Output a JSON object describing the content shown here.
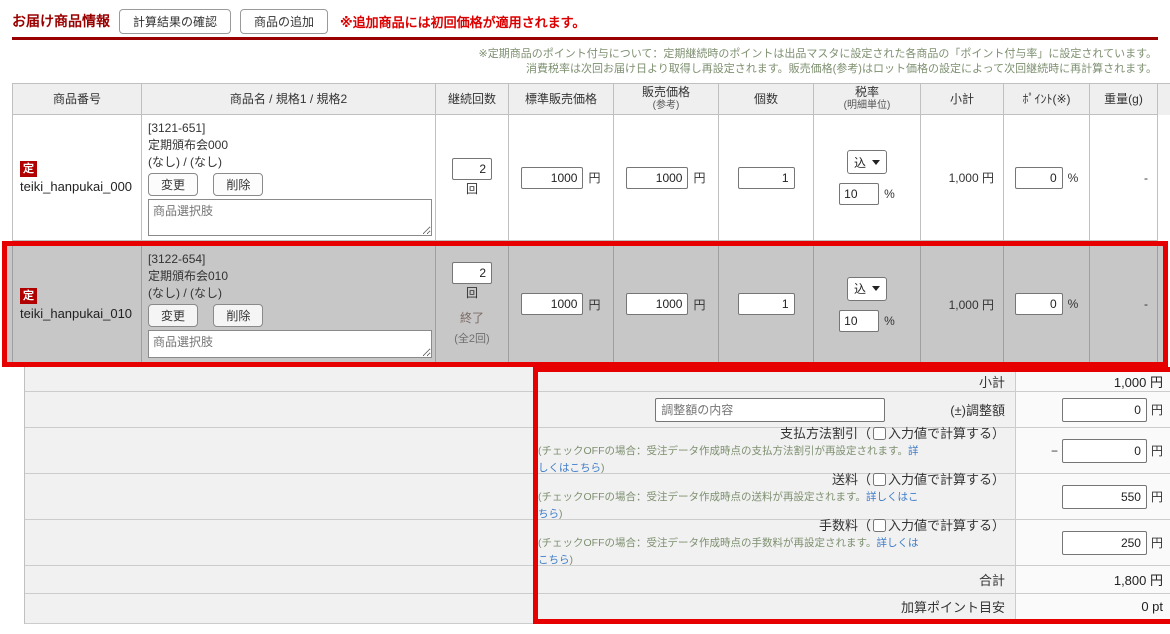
{
  "header": {
    "title": "お届け商品情報",
    "calc_button": "計算結果の確認",
    "add_button": "商品の追加",
    "warning": "※追加商品には初回価格が適用されます。"
  },
  "notice": {
    "line1": "※定期商品のポイント付与について：定期継続時のポイントは出品マスタに設定された各商品の「ポイント付与率」に設定されています。",
    "line2": "消費税率は次回お届け日より取得し再設定されます。販売価格(参考)はロット価格の設定によって次回継続時に再計算されます。"
  },
  "columns": {
    "code": "商品番号",
    "name": "商品名 / 規格1 / 規格2",
    "continue_count": "継続回数",
    "standard_price": "標準販売価格",
    "sale_price": "販売価格",
    "sale_price_sub": "(参考)",
    "quantity": "個数",
    "tax": "税率",
    "tax_sub": "(明細単位)",
    "subtotal": "小計",
    "point": "ﾎﾟｲﾝﾄ(※)",
    "weight": "重量(g)"
  },
  "labels": {
    "yen": "円",
    "percent": "%",
    "kai": "回",
    "change": "変更",
    "delete": "削除",
    "minus": "−"
  },
  "rows": [
    {
      "badge": "定",
      "code": "teiki_hanpukai_000",
      "product_id": "[3121-651]",
      "product_name": "定期頒布会000",
      "spec": "(なし) / (なし)",
      "option_placeholder": "商品選択肢",
      "continue_count": "2",
      "standard_price": "1000",
      "sale_price": "1000",
      "quantity": "1",
      "tax_type": "込",
      "tax_rate": "10",
      "subtotal": "1,000 円",
      "point": "0",
      "weight": "-"
    },
    {
      "badge": "定",
      "code": "teiki_hanpukai_010",
      "product_id": "[3122-654]",
      "product_name": "定期頒布会010",
      "spec": "(なし) / (なし)",
      "option_placeholder": "商品選択肢",
      "continue_count": "2",
      "end_label": "終了",
      "end_total": "(全2回)",
      "standard_price": "1000",
      "sale_price": "1000",
      "quantity": "1",
      "tax_type": "込",
      "tax_rate": "10",
      "subtotal": "1,000 円",
      "point": "0",
      "weight": "-"
    }
  ],
  "summary": {
    "subtotal": {
      "label": "小計",
      "value": "1,000 円"
    },
    "adjustment": {
      "placeholder": "調整額の内容",
      "label": "(±)調整額",
      "value": "0"
    },
    "payment_discount": {
      "name": "支払方法割引",
      "checkbox_prefix": "（",
      "checkbox_suffix": "入力値で計算する）",
      "note": "(チェックOFFの場合：受注データ作成時点の支払方法割引が再設定されます。",
      "link": "詳しくはこちら",
      "note_close": ")",
      "minus": "−",
      "value": "0"
    },
    "shipping": {
      "name": "送料",
      "checkbox_prefix": "（",
      "checkbox_suffix": "入力値で計算する）",
      "note": "(チェックOFFの場合：受注データ作成時点の送料が再設定されます。",
      "link": "詳しくはこちら",
      "note_close": ")",
      "value": "550"
    },
    "fee": {
      "name": "手数料",
      "checkbox_prefix": "（",
      "checkbox_suffix": "入力値で計算する）",
      "note": "(チェックOFFの場合：受注データ作成時点の手数料が再設定されます。",
      "link": "詳しくはこちら",
      "note_close": ")",
      "value": "250"
    },
    "total": {
      "label": "合計",
      "value": "1,800 円"
    },
    "points": {
      "label": "加算ポイント目安",
      "value": "0 pt"
    }
  },
  "colors": {
    "accent_red": "#e60000",
    "title_red": "#990000",
    "warning_red": "#dd0000",
    "notice_green": "#7e9070",
    "link_blue": "#3d7cc9",
    "badge_red": "#b00000",
    "highlight_row_bg": "#c7c7c7"
  }
}
